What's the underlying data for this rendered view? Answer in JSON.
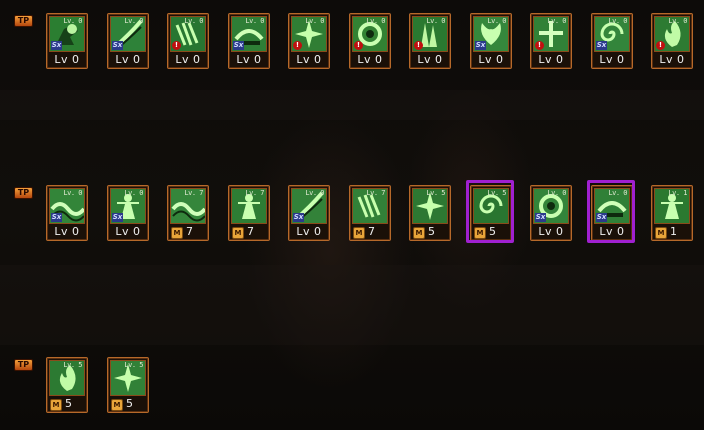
{
  "rows": [
    {
      "tag": "TP",
      "skills": [
        {
          "name": "skill-1",
          "level_small": "Lv. 0",
          "bottom": "Lv 0",
          "mastery": false,
          "badge": "sx",
          "color": "#3fb84a",
          "glyph": "fist-icon"
        },
        {
          "name": "skill-2",
          "level_small": "Lv. 0",
          "bottom": "Lv 0",
          "mastery": false,
          "badge": "sx",
          "color": "#46c05a",
          "glyph": "slash-icon"
        },
        {
          "name": "skill-3",
          "level_small": "Lv. 0",
          "bottom": "Lv 0",
          "mastery": false,
          "badge": "alert",
          "color": "#3ba94a",
          "glyph": "claw-icon"
        },
        {
          "name": "skill-4",
          "level_small": "Lv. 0",
          "bottom": "Lv 0",
          "mastery": false,
          "badge": "sx",
          "color": "#45b854",
          "glyph": "sweep-icon"
        },
        {
          "name": "skill-5",
          "level_small": "Lv. 0",
          "bottom": "Lv 0",
          "mastery": false,
          "badge": "alert",
          "color": "#49b850",
          "glyph": "burst-icon"
        },
        {
          "name": "skill-6",
          "level_small": "Lv. 0",
          "bottom": "Lv 0",
          "mastery": false,
          "badge": "alert",
          "color": "#4cbf4f",
          "glyph": "ring-icon"
        },
        {
          "name": "skill-7",
          "level_small": "Lv. 0",
          "bottom": "Lv 0",
          "mastery": false,
          "badge": "alert",
          "color": "#3eae48",
          "glyph": "spike-icon"
        },
        {
          "name": "skill-8",
          "level_small": "Lv. 0",
          "bottom": "Lv 0",
          "mastery": false,
          "badge": "sx",
          "color": "#52c85e",
          "glyph": "wing-icon"
        },
        {
          "name": "skill-9",
          "level_small": "Lv. 0",
          "bottom": "Lv 0",
          "mastery": false,
          "badge": "alert",
          "color": "#4bbd55",
          "glyph": "cross-icon"
        },
        {
          "name": "skill-10",
          "level_small": "Lv. 0",
          "bottom": "Lv 0",
          "mastery": false,
          "badge": "sx",
          "color": "#4fc45c",
          "glyph": "swirl-icon"
        },
        {
          "name": "skill-11",
          "level_small": "Lv. 0",
          "bottom": "Lv 0",
          "mastery": false,
          "badge": "alert",
          "color": "#44b24d",
          "glyph": "flame-icon"
        }
      ]
    },
    {
      "tag": "TP",
      "skills": [
        {
          "name": "skill-12",
          "level_small": "Lv. 0",
          "bottom": "Lv 0",
          "mastery": false,
          "badge": "sx",
          "color": "#4fc45a",
          "glyph": "wave-icon"
        },
        {
          "name": "skill-13",
          "level_small": "Lv. 0",
          "bottom": "Lv 0",
          "mastery": false,
          "badge": "sx",
          "color": "#48bb52",
          "glyph": "figure-icon"
        },
        {
          "name": "skill-14",
          "level_small": "Lv. 7",
          "bottom": "7",
          "mastery": true,
          "badge": "",
          "color": "#52c65c",
          "glyph": "wave-icon"
        },
        {
          "name": "skill-15",
          "level_small": "Lv. 7",
          "bottom": "7",
          "mastery": true,
          "badge": "",
          "color": "#45b750",
          "glyph": "figure-icon"
        },
        {
          "name": "skill-16",
          "level_small": "Lv. 0",
          "bottom": "Lv 0",
          "mastery": false,
          "badge": "sx",
          "color": "#4ec05a",
          "glyph": "slash-icon"
        },
        {
          "name": "skill-17",
          "level_small": "Lv. 7",
          "bottom": "7",
          "mastery": true,
          "badge": "",
          "color": "#4cbe57",
          "glyph": "claw-icon"
        },
        {
          "name": "skill-18",
          "level_small": "Lv. 5",
          "bottom": "5",
          "mastery": true,
          "badge": "",
          "color": "#43ad4c",
          "glyph": "burst-icon"
        },
        {
          "name": "skill-19",
          "level_small": "Lv. 5",
          "bottom": "5",
          "mastery": true,
          "badge": "",
          "color": "#3da748",
          "glyph": "swirl-icon",
          "selected": true
        },
        {
          "name": "skill-20",
          "level_small": "Lv. 0",
          "bottom": "Lv 0",
          "mastery": false,
          "badge": "sx",
          "color": "#4fc35b",
          "glyph": "ring-icon"
        },
        {
          "name": "skill-21",
          "level_small": "Lv. 0",
          "bottom": "Lv 0",
          "mastery": false,
          "badge": "sx",
          "color": "#49bb55",
          "glyph": "sweep-icon",
          "selected": true
        },
        {
          "name": "skill-22",
          "level_small": "Lv. 1",
          "bottom": "1",
          "mastery": true,
          "badge": "",
          "color": "#3fae49",
          "glyph": "figure-icon"
        }
      ]
    },
    {
      "tag": "TP",
      "skills": [
        {
          "name": "skill-23",
          "level_small": "Lv. 5",
          "bottom": "5",
          "mastery": true,
          "badge": "",
          "color": "#41b04c",
          "glyph": "flame-icon"
        },
        {
          "name": "skill-24",
          "level_small": "Lv. 5",
          "bottom": "5",
          "mastery": true,
          "badge": "",
          "color": "#4abd55",
          "glyph": "burst-icon"
        }
      ]
    }
  ],
  "mastery_label": "M"
}
